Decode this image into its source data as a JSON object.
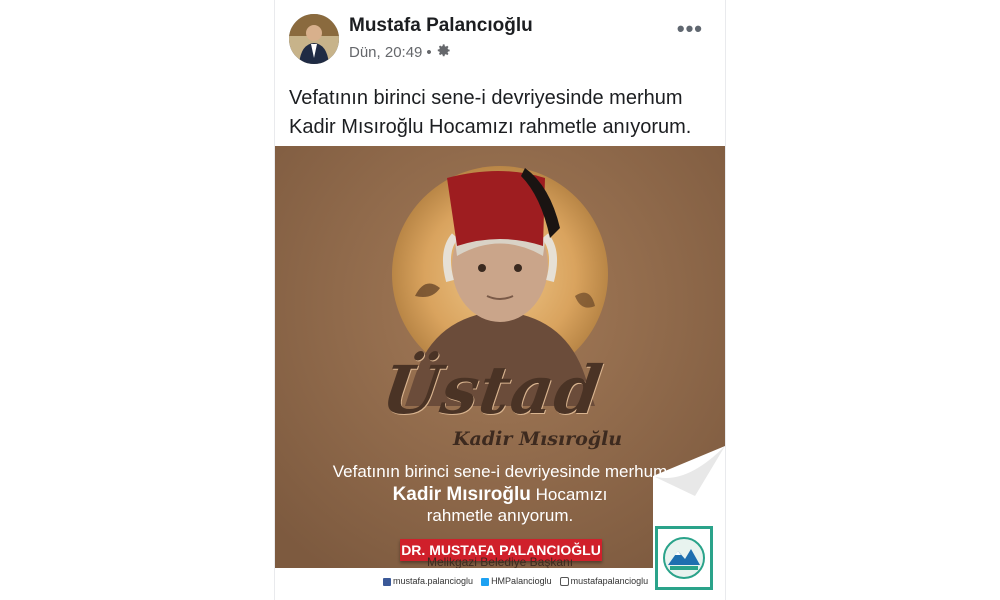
{
  "post": {
    "author": "Mustafa Palancıoğlu",
    "timestamp": "Dün, 20:49",
    "separator": "•",
    "more_icon": "•••",
    "caption_line1": "Vefatının birinci sene-i devriyesinde merhum",
    "caption_line2": "Kadir Mısıroğlu Hocamızı rahmetle anıyorum."
  },
  "image": {
    "headline": "Üstad",
    "name": "Kadir Mısıroğlu",
    "message_line1": "Vefatının birinci sene-i devriyesinde merhum",
    "message_line2_bold": "Kadir Mısıroğlu",
    "message_line2_rest": " Hocamızı",
    "message_line3": "rahmetle anıyorum.",
    "banner": "DR. MUSTAFA PALANCIOĞLU",
    "banner_sub": "Melikgazi Belediye Başkanı",
    "social": {
      "facebook": "mustafa.palancioglu",
      "twitter": "HMPalancioglu",
      "instagram": "mustafapalancioglu"
    }
  },
  "colors": {
    "background": "#8b6548",
    "banner": "#d0202b",
    "logo_border": "#2aa38a"
  }
}
